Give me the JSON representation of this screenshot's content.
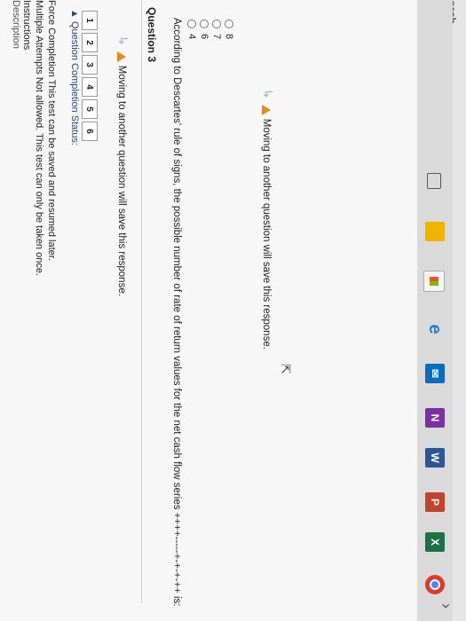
{
  "search": {
    "text": "arch"
  },
  "header": {
    "description": "Description",
    "instructions": "Instructions",
    "multiple_attempts": "Multiple Attempts  Not allowed. This test can only be taken once.",
    "force_completion": "Force Completion  This test can be saved and resumed later."
  },
  "completion": {
    "title": "Question Completion Status:",
    "numbers": [
      "1",
      "2",
      "3",
      "4",
      "5",
      "6"
    ]
  },
  "notices": {
    "moving_save_1": "Moving to another question will save this response.",
    "moving_save_2": "Moving to another question will save this response."
  },
  "question": {
    "label": "Question 3",
    "text": "According to Descartes' rule of signs, the possible number of rate of return values for the net cash flow series ++++-----+-+-+-++ is:",
    "options": [
      "4",
      "6",
      "7",
      "8"
    ]
  },
  "taskbar": {
    "icons": [
      "task-view-icon",
      "file-explorer-icon",
      "store-icon",
      "edge-icon",
      "mail-icon",
      "onenote-icon",
      "word-icon",
      "powerpoint-icon",
      "excel-icon",
      "chrome-icon"
    ],
    "colors": {
      "explorer": "#f0b400",
      "store": "#1e7fd2",
      "edge": "#1e7fd2",
      "mail": "#0b6bbf",
      "onenote": "#7b2fa3",
      "word": "#2b5797",
      "powerpoint": "#c0442a",
      "excel": "#1e7145",
      "chrome": "#de3b2f"
    }
  }
}
